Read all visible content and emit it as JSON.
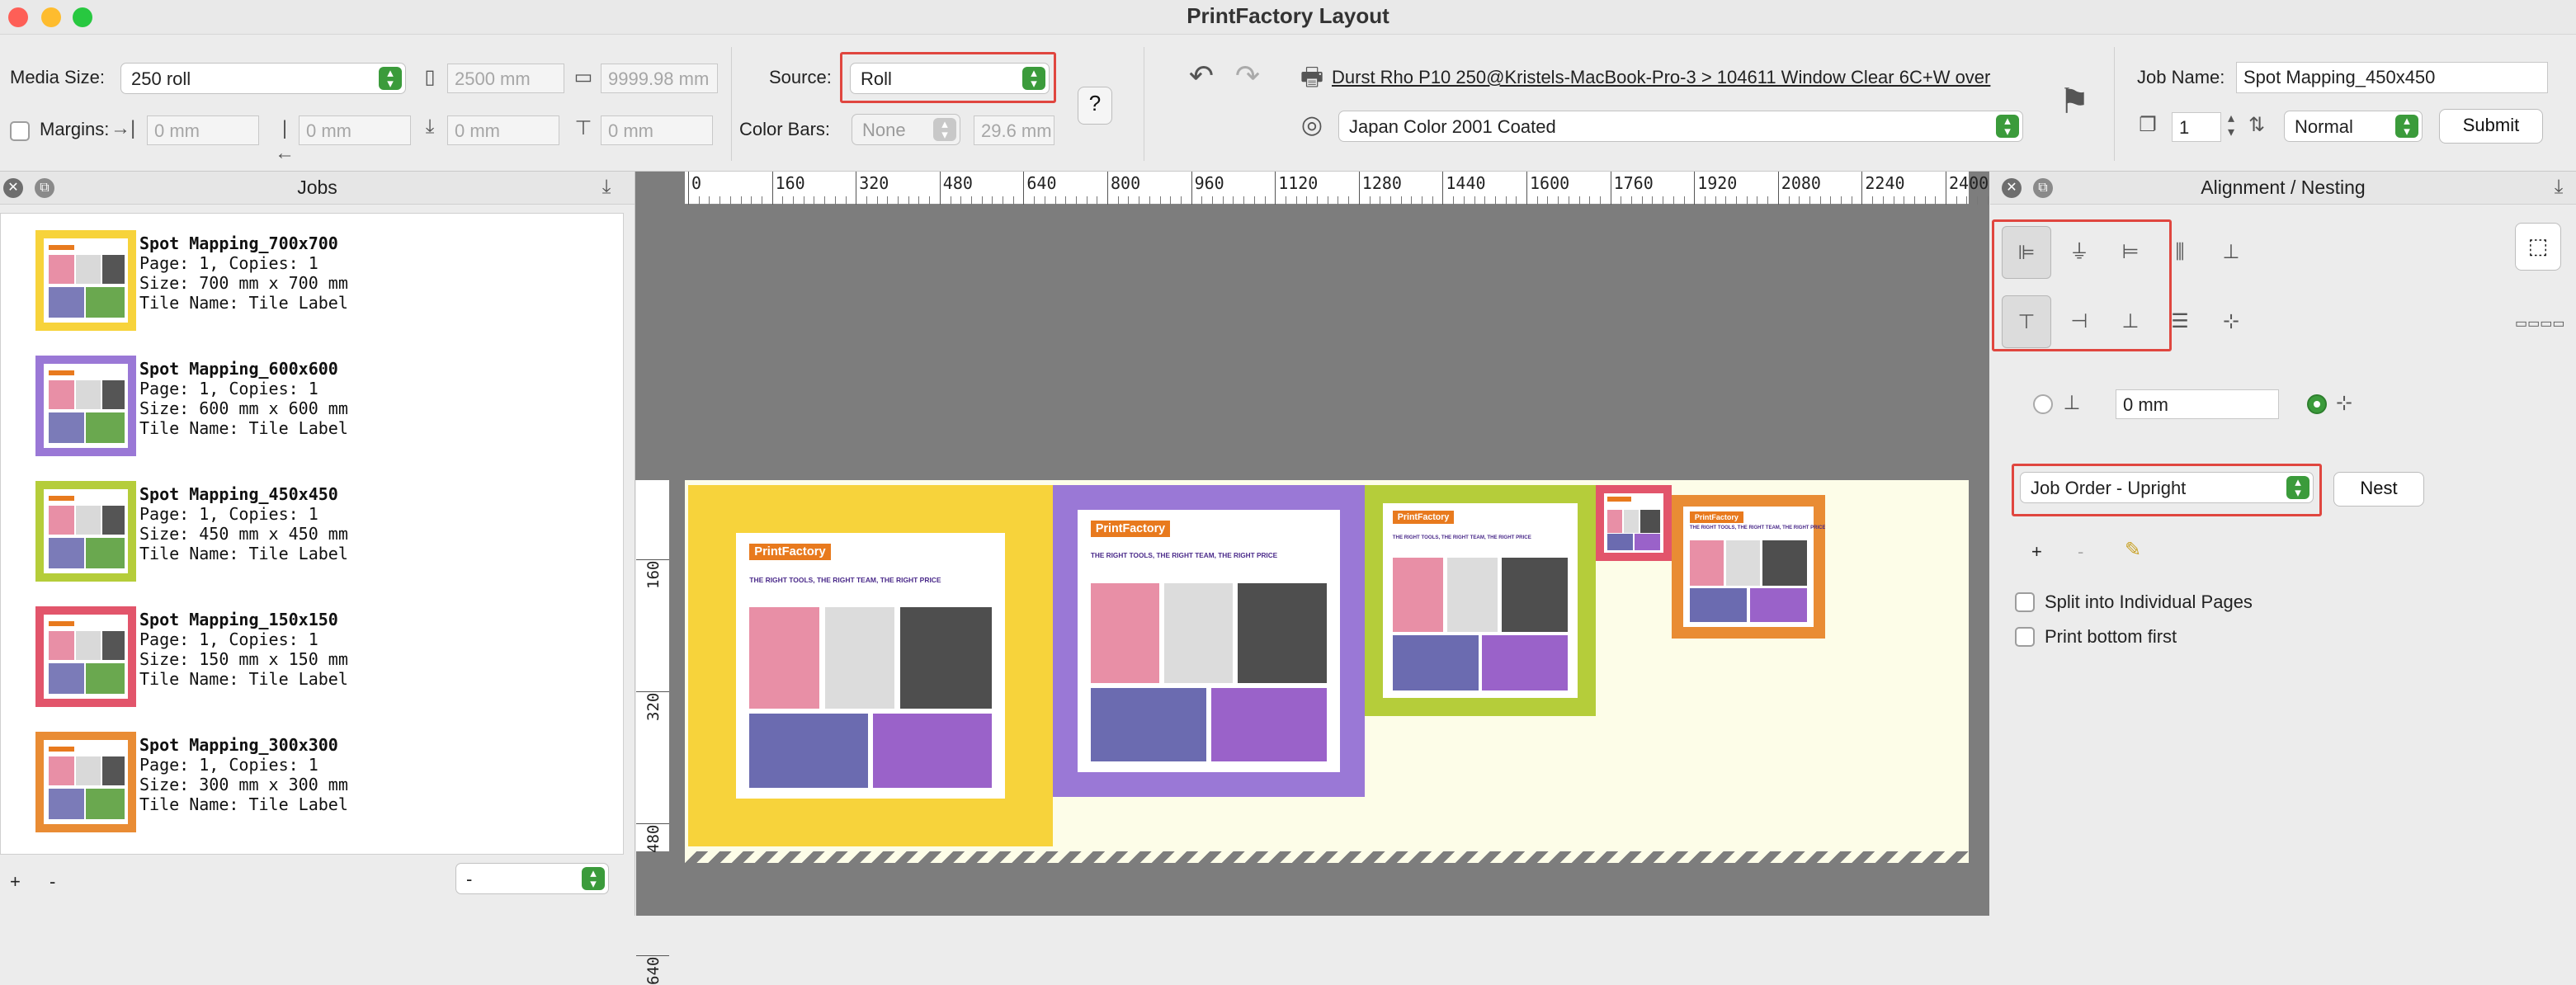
{
  "window": {
    "title": "PrintFactory Layout"
  },
  "toolbar": {
    "media_size_label": "Media Size:",
    "media_size_value": "250 roll",
    "width_value": "2500 mm",
    "height_value": "9999.98 mm",
    "margins_label": "Margins:",
    "margin_left": "0 mm",
    "margin_right": "0 mm",
    "margin_bottom": "0 mm",
    "margin_top": "0 mm",
    "source_label": "Source:",
    "source_value": "Roll",
    "color_bars_label": "Color Bars:",
    "color_bars_value": "None",
    "color_bars_size": "29.6 mm",
    "printer": "Durst Rho P10 250@Kristels-MacBook-Pro-3 > 104611 Window Clear 6C+W over",
    "color_profile": "Japan Color 2001 Coated",
    "job_name_label": "Job Name:",
    "job_name_value": "Spot Mapping_450x450",
    "copies_value": "1",
    "mode_value": "Normal",
    "submit_label": "Submit"
  },
  "jobs_panel": {
    "title": "Jobs",
    "items": [
      {
        "name": "Spot Mapping_700x700",
        "page_copies": "Page: 1, Copies: 1",
        "size": "Size: 700 mm x 700 mm",
        "tile": "Tile Name: Tile Label",
        "color": "#f7d33b"
      },
      {
        "name": "Spot Mapping_600x600",
        "page_copies": "Page: 1, Copies: 1",
        "size": "Size: 600 mm x 600 mm",
        "tile": "Tile Name: Tile Label",
        "color": "#9a78d6"
      },
      {
        "name": "Spot Mapping_450x450",
        "page_copies": "Page: 1, Copies: 1",
        "size": "Size: 450 mm x 450 mm",
        "tile": "Tile Name: Tile Label",
        "color": "#b5cd3a"
      },
      {
        "name": "Spot Mapping_150x150",
        "page_copies": "Page: 1, Copies: 1",
        "size": "Size: 150 mm x 150 mm",
        "tile": "Tile Name: Tile Label",
        "color": "#e2556b"
      },
      {
        "name": "Spot Mapping_300x300",
        "page_copies": "Page: 1, Copies: 1",
        "size": "Size: 300 mm x 300 mm",
        "tile": "Tile Name: Tile Label",
        "color": "#e98c34"
      }
    ],
    "add_label": "+",
    "remove_label": "-",
    "filter_value": "-"
  },
  "canvas": {
    "ruler_top": [
      "0",
      "160",
      "320",
      "480",
      "640",
      "800",
      "960",
      "1120",
      "1280",
      "1440",
      "1600",
      "1760",
      "1920",
      "2080",
      "2240",
      "2400"
    ],
    "ruler_left": [
      "160",
      "320",
      "480",
      "640"
    ],
    "poster": {
      "brand": "PrintFactory",
      "tagline": "THE RIGHT TOOLS, THE RIGHT TEAM, THE RIGHT PRICE"
    }
  },
  "alignment_panel": {
    "title": "Alignment / Nesting",
    "spacing_value": "0 mm",
    "order_value": "Job Order - Upright",
    "nest_label": "Nest",
    "add_label": "+",
    "remove_label": "-",
    "split_label": "Split into Individual Pages",
    "print_bottom_label": "Print bottom first"
  },
  "colors": {
    "accent": "#3b9b3b",
    "highlight": "#e0463f",
    "canvas_bg": "#7d7d7d",
    "media": "#fdfde8"
  }
}
